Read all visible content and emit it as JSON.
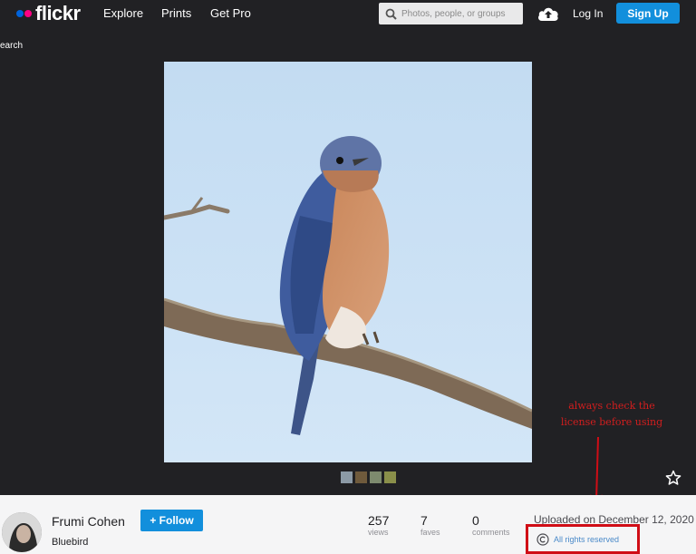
{
  "header": {
    "logo_text": "flickr",
    "nav": [
      "Explore",
      "Prints",
      "Get Pro"
    ],
    "search_placeholder": "Photos, people, or groups",
    "login_label": "Log In",
    "signup_label": "Sign Up"
  },
  "stage": {
    "back_label": "earch",
    "annotation_lines": [
      "always check the",
      "license before using"
    ]
  },
  "footer": {
    "owner_name": "Frumi Cohen",
    "follow_label": "+ Follow",
    "photo_title": "Bluebird",
    "stats": [
      {
        "value": "257",
        "label": "views"
      },
      {
        "value": "7",
        "label": "faves"
      },
      {
        "value": "0",
        "label": "comments"
      }
    ],
    "uploaded_text": "Uploaded on December 12, 2020",
    "license_text": "All rights reserved"
  },
  "colors": {
    "nav_bg": "#212124",
    "brand_blue": "#0063dc",
    "brand_pink": "#ff0084",
    "button_blue": "#128fdc",
    "annotation_red": "#d00d16"
  }
}
